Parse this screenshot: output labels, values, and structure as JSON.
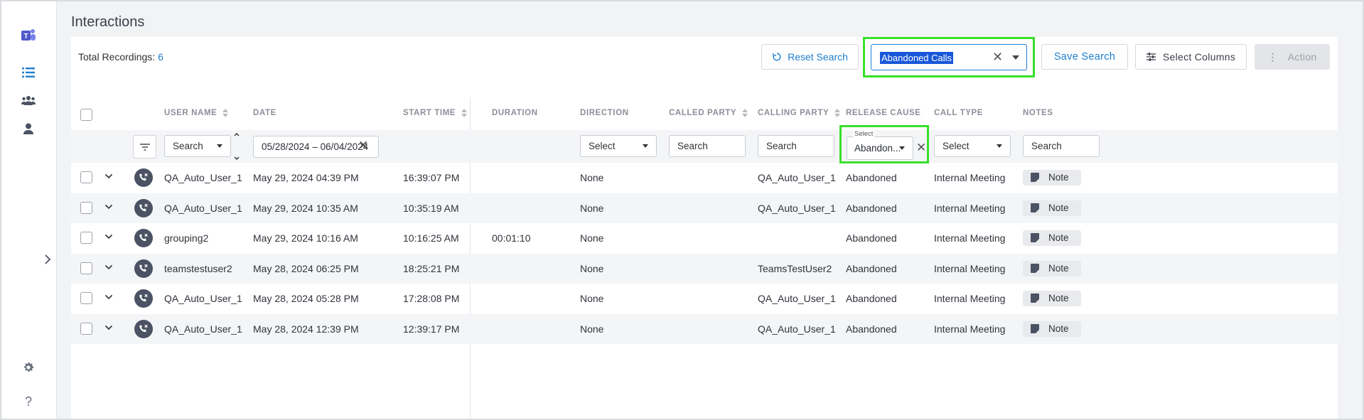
{
  "page_title": "Interactions",
  "total": {
    "label": "Total Recordings:",
    "count": "6"
  },
  "toolbar": {
    "reset_label": "Reset Search",
    "saved_search_value": "Abandoned Calls",
    "save_label": "Save Search",
    "columns_label": "Select Columns",
    "action_label": "Action"
  },
  "columns": {
    "user_name": "USER NAME",
    "date": "DATE",
    "start_time": "START TIME",
    "duration": "DURATION",
    "direction": "DIRECTION",
    "called_party": "CALLED PARTY",
    "calling_party": "CALLING PARTY",
    "release_cause": "RELEASE CAUSE",
    "call_type": "CALL TYPE",
    "notes": "NOTES"
  },
  "filters": {
    "user_name": "Search",
    "date_range": "05/28/2024 – 06/04/2024",
    "direction": "Select",
    "called_party": "Search",
    "calling_party": "Search",
    "release_cause_legend": "Select",
    "release_cause": "Abandon...",
    "call_type": "Select",
    "notes": "Search"
  },
  "rows": [
    {
      "user": "QA_Auto_User_1",
      "date": "May 29, 2024 04:39 PM",
      "start": "16:39:07 PM",
      "duration": "",
      "direction": "None",
      "called": "",
      "calling": "QA_Auto_User_1",
      "cause": "Abandoned",
      "type": "Internal Meeting",
      "note": "Note"
    },
    {
      "user": "QA_Auto_User_1",
      "date": "May 29, 2024 10:35 AM",
      "start": "10:35:19 AM",
      "duration": "",
      "direction": "None",
      "called": "",
      "calling": "QA_Auto_User_1",
      "cause": "Abandoned",
      "type": "Internal Meeting",
      "note": "Note"
    },
    {
      "user": "grouping2",
      "date": "May 29, 2024 10:16 AM",
      "start": "10:16:25 AM",
      "duration": "00:01:10",
      "direction": "None",
      "called": "",
      "calling": "",
      "cause": "Abandoned",
      "type": "Internal Meeting",
      "note": "Note"
    },
    {
      "user": "teamstestuser2",
      "date": "May 28, 2024 06:25 PM",
      "start": "18:25:21 PM",
      "duration": "",
      "direction": "None",
      "called": "",
      "calling": "TeamsTestUser2",
      "cause": "Abandoned",
      "type": "Internal Meeting",
      "note": "Note"
    },
    {
      "user": "QA_Auto_User_1",
      "date": "May 28, 2024 05:28 PM",
      "start": "17:28:08 PM",
      "duration": "",
      "direction": "None",
      "called": "",
      "calling": "QA_Auto_User_1",
      "cause": "Abandoned",
      "type": "Internal Meeting",
      "note": "Note"
    },
    {
      "user": "QA_Auto_User_1",
      "date": "May 28, 2024 12:39 PM",
      "start": "12:39:17 PM",
      "duration": "",
      "direction": "None",
      "called": "",
      "calling": "QA_Auto_User_1",
      "cause": "Abandoned",
      "type": "Internal Meeting",
      "note": "Note"
    }
  ],
  "sidebar": {
    "icons": [
      "teams-logo-icon",
      "interactions-list-icon",
      "groups-icon",
      "user-icon",
      "settings-icon",
      "help-icon"
    ]
  },
  "colors": {
    "accent": "#1f7ecf",
    "highlight": "#39e02a",
    "selection": "#1857d9"
  }
}
